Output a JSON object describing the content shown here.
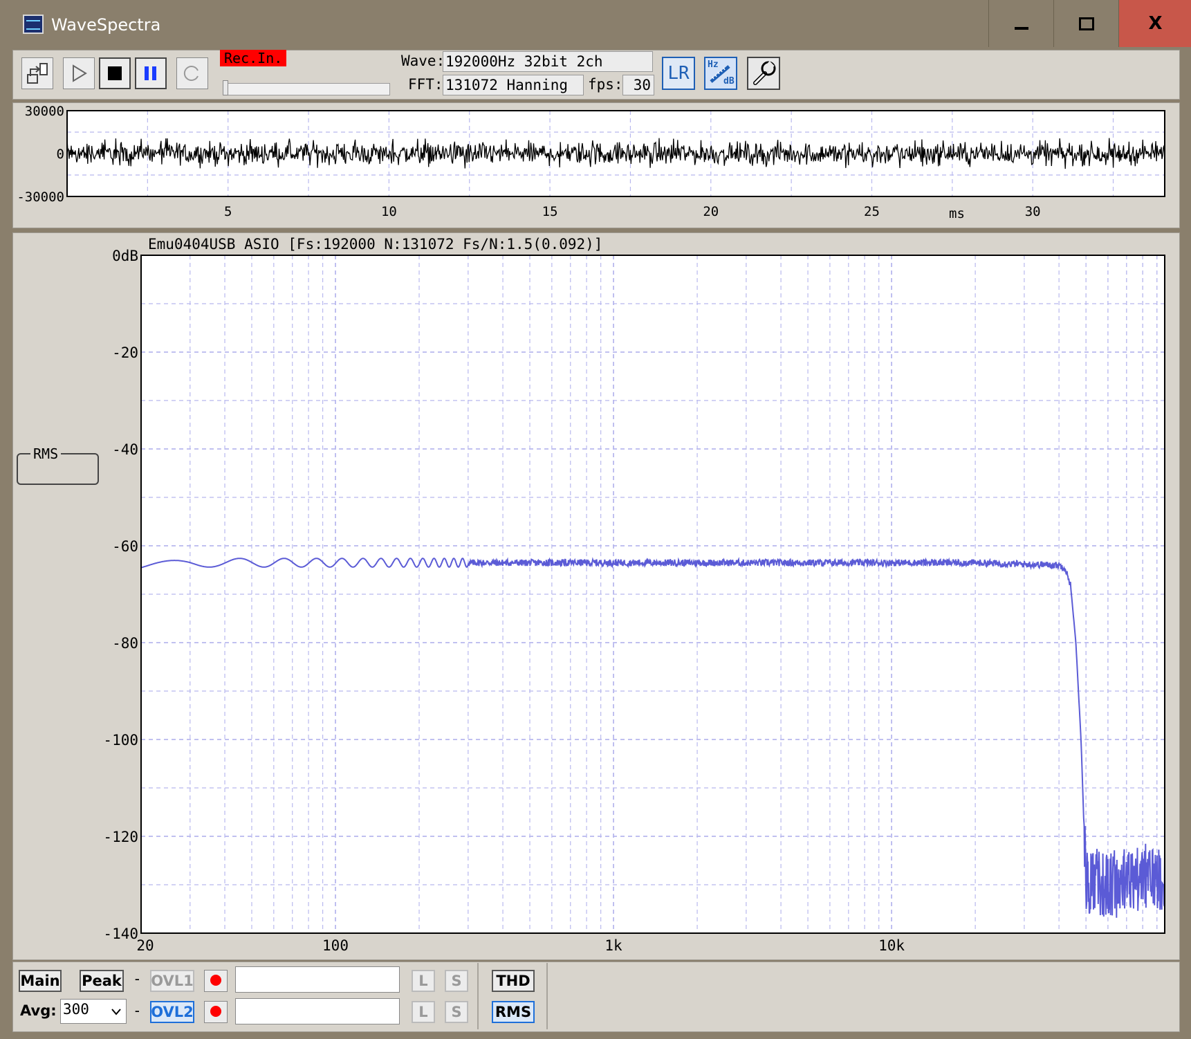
{
  "window": {
    "title": "WaveSpectra",
    "controls": {
      "minimize": "minimize",
      "maximize": "maximize",
      "close": "X"
    }
  },
  "toolbar": {
    "rec_label": "Rec.In.",
    "wave_label": "Wave:",
    "wave_value": "192000Hz 32bit 2ch",
    "fft_label": "FFT:",
    "fft_value": "131072 Hanning",
    "fps_label": "fps:",
    "fps_value": "30",
    "lr_button": "LR",
    "hzdb_top": "Hz",
    "hzdb_bottom": "dB",
    "icons": [
      "export-icon",
      "play-icon",
      "stop-icon",
      "pause-icon",
      "refresh-icon",
      "lr-icon",
      "hz-db-icon",
      "wrench-icon"
    ]
  },
  "spectrum_header": "Emu0404USB ASIO  [Fs:192000 N:131072 Fs/N:1.5(0.092)]",
  "rms_group_label": "RMS",
  "bottom": {
    "main": "Main",
    "peak": "Peak",
    "dash1": "-",
    "dash2": "-",
    "ovl1": "OVL1",
    "ovl2": "OVL2",
    "avg_label": "Avg:",
    "avg_value": "300",
    "l": "L",
    "s": "S",
    "thd": "THD",
    "rms": "RMS"
  },
  "colors": {
    "spectrum_line": "#5b5bd6",
    "grid": "#b8b8ee",
    "rec_bg": "#ff0000",
    "close_bg": "#c8574a"
  },
  "chart_data": [
    {
      "type": "line",
      "title": "",
      "xlabel": "ms",
      "ylabel": "",
      "xlim": [
        0,
        34.1
      ],
      "ylim": [
        -30000,
        30000
      ],
      "x_ticks": [
        5,
        10,
        15,
        20,
        25,
        30
      ],
      "x_tick_labels": [
        "5",
        "10",
        "15",
        "20",
        "25",
        "30"
      ],
      "y_ticks": [
        30000,
        0,
        -30000
      ],
      "y_tick_labels": [
        "30000",
        "0",
        "-30000"
      ],
      "grid": true,
      "series": [
        {
          "description": "white noise waveform",
          "amplitude_approx": 7000,
          "peak_approx": 11000
        }
      ]
    },
    {
      "type": "line",
      "title": "Emu0404USB ASIO  [Fs:192000 N:131072 Fs/N:1.5(0.092)]",
      "xscale": "log",
      "xlim": [
        20,
        96000
      ],
      "ylim": [
        -140,
        0
      ],
      "x_tick_labels": [
        "20",
        "100",
        "1k",
        "10k"
      ],
      "x_ticks": [
        20,
        100,
        1000,
        10000
      ],
      "y_ticks": [
        0,
        -20,
        -40,
        -60,
        -80,
        -100,
        -120,
        -140
      ],
      "y_tick_labels": [
        "0dB",
        "-20",
        "-40",
        "-60",
        "-80",
        "-100",
        "-120",
        "-140"
      ],
      "grid": true,
      "legend": "none",
      "series": [
        {
          "x": [
            20,
            25,
            30,
            40,
            60,
            100,
            200,
            500,
            1000,
            2000,
            5000,
            10000,
            20000,
            30000,
            40000,
            42000,
            44000,
            46000,
            48000,
            49000,
            50000,
            55000,
            60000,
            70000,
            80000,
            96000
          ],
          "y": [
            -64.5,
            -64,
            -63.5,
            -63.5,
            -63.5,
            -63.5,
            -63.5,
            -63.5,
            -63.5,
            -63.5,
            -63.5,
            -63.5,
            -63.5,
            -63.8,
            -64,
            -64.5,
            -68,
            -80,
            -100,
            -115,
            -128,
            -128,
            -129,
            -128,
            -127,
            -127
          ]
        }
      ]
    }
  ]
}
